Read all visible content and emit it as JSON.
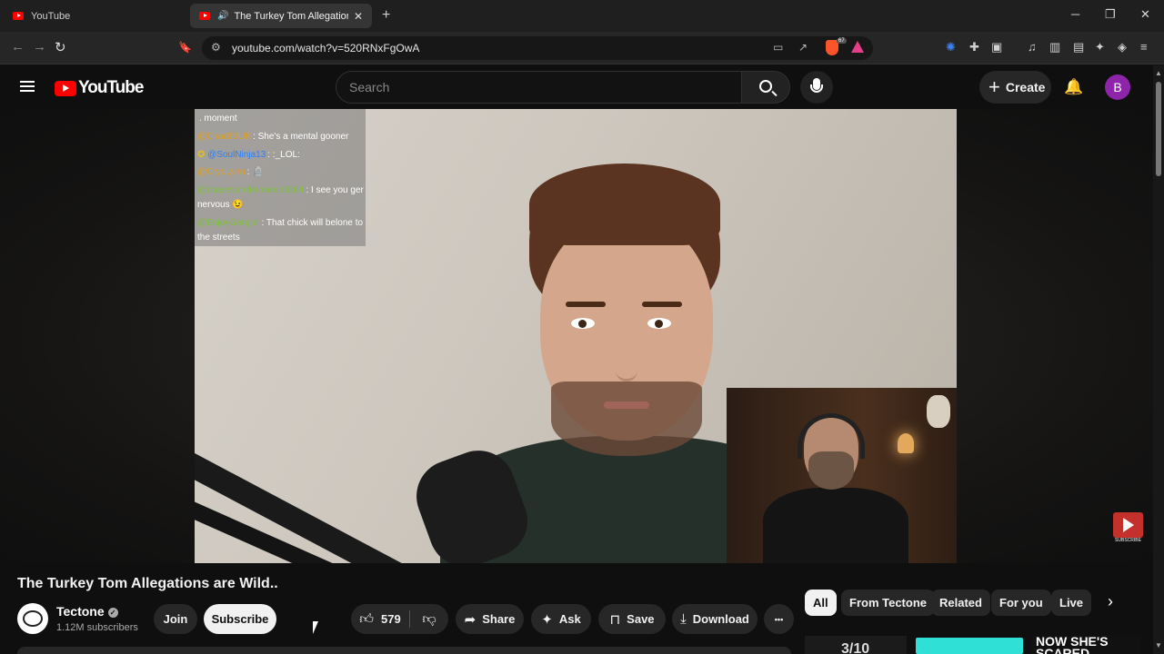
{
  "browser": {
    "tabs": [
      {
        "title": "YouTube"
      },
      {
        "title": "The Turkey Tom Allegations a",
        "playing": true
      }
    ],
    "new_tab": "+",
    "window_controls": {
      "minimize": "─",
      "maximize": "❐",
      "close": "✕"
    },
    "nav": {
      "back": "←",
      "forward": "→",
      "reload": "↻",
      "bookmark": "🔖"
    },
    "url": "youtube.com/watch?v=520RNxFgOwA",
    "shields_badge": "67"
  },
  "header": {
    "logo_text": "YouTube",
    "search_placeholder": "Search",
    "create_label": "Create",
    "create_icon": "+",
    "notifications_icon": "🔔",
    "avatar_letter": "B",
    "avatar_color": "#8e24aa"
  },
  "video": {
    "chat": [
      {
        "user": "",
        "text": ". moment",
        "user_color": "#7fbf3f"
      },
      {
        "user": "@Chad69UK",
        "text": ": She's a mental gooner",
        "user_color": "#e0a020"
      },
      {
        "user": "@SoulNinja13",
        "text": ": :_LOL:",
        "user_color": "#2a7fff"
      },
      {
        "user": "@CryoLynn",
        "text": ": 🪦",
        "user_color": "#e0a020"
      },
      {
        "user": "@chasevanderheede9264",
        "text": ": I see you ger nervous 😉",
        "user_color": "#7fbf3f"
      },
      {
        "user": "@EnjoyGengar",
        "text": ": That chick will belone to the streets",
        "user_color": "#7fbf3f"
      }
    ],
    "subscribe_watermark": "SUBSCRIBE"
  },
  "meta": {
    "title": "The Turkey Tom Allegations are Wild..",
    "channel_name": "Tectone",
    "verified_icon": "✓",
    "subscribers": "1.12M subscribers",
    "join_label": "Join",
    "subscribe_label": "Subscribe",
    "like_count": "579",
    "share_label": "Share",
    "ask_label": "Ask",
    "save_label": "Save",
    "download_label": "Download",
    "more_icon": "•••"
  },
  "chips": {
    "items": [
      "All",
      "From Tectone",
      "Related",
      "For you",
      "Live"
    ],
    "active": "All",
    "next_icon": "›"
  },
  "recommendations": {
    "thumb1_text": "3/10",
    "thumb3_text": "NOW SHE'S SCARED"
  }
}
